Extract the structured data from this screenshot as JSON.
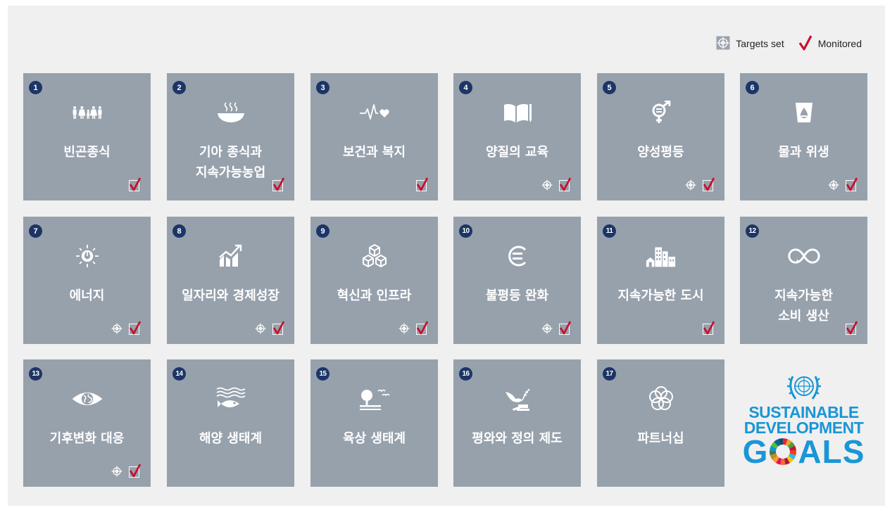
{
  "legend": {
    "targets_label": "Targets set",
    "monitored_label": "Monitored",
    "targets_icon": "target-icon",
    "monitored_icon": "checkmark-icon"
  },
  "goals": [
    {
      "number": "1",
      "title": "빈곤종식",
      "icon": "family-icon",
      "targets_set": false,
      "monitored": true
    },
    {
      "number": "2",
      "title": "기아 종식과\n지속가능농업",
      "icon": "food-bowl-icon",
      "targets_set": false,
      "monitored": true
    },
    {
      "number": "3",
      "title": "보건과 복지",
      "icon": "heartbeat-icon",
      "targets_set": false,
      "monitored": true
    },
    {
      "number": "4",
      "title": "양질의 교육",
      "icon": "book-pencil-icon",
      "targets_set": true,
      "monitored": true
    },
    {
      "number": "5",
      "title": "양성평등",
      "icon": "gender-equality-icon",
      "targets_set": true,
      "monitored": true
    },
    {
      "number": "6",
      "title": "물과 위생",
      "icon": "water-glass-icon",
      "targets_set": true,
      "monitored": true
    },
    {
      "number": "7",
      "title": "에너지",
      "icon": "sun-power-icon",
      "targets_set": true,
      "monitored": true
    },
    {
      "number": "8",
      "title": "일자리와 경제성장",
      "icon": "growth-chart-icon",
      "targets_set": true,
      "monitored": true
    },
    {
      "number": "9",
      "title": "혁신과 인프라",
      "icon": "cubes-icon",
      "targets_set": true,
      "monitored": true
    },
    {
      "number": "10",
      "title": "불평등 완화",
      "icon": "equal-sign-icon",
      "targets_set": true,
      "monitored": true
    },
    {
      "number": "11",
      "title": "지속가능한 도시",
      "icon": "city-buildings-icon",
      "targets_set": false,
      "monitored": true
    },
    {
      "number": "12",
      "title": "지속가능한\n소비 생산",
      "icon": "infinity-loop-icon",
      "targets_set": false,
      "monitored": true
    },
    {
      "number": "13",
      "title": "기후변화 대응",
      "icon": "eye-globe-icon",
      "targets_set": true,
      "monitored": true
    },
    {
      "number": "14",
      "title": "해양 생태계",
      "icon": "fish-waves-icon",
      "targets_set": false,
      "monitored": false
    },
    {
      "number": "15",
      "title": "육상 생태계",
      "icon": "tree-birds-icon",
      "targets_set": false,
      "monitored": false
    },
    {
      "number": "16",
      "title": "평와와 정의 제도",
      "icon": "dove-gavel-icon",
      "targets_set": false,
      "monitored": false
    },
    {
      "number": "17",
      "title": "파트너십",
      "icon": "interlocking-rings-icon",
      "targets_set": false,
      "monitored": false
    }
  ],
  "logo": {
    "line1": "SUSTAINABLE",
    "line2": "DEVELOPMENT",
    "goals_left": "G",
    "goals_right": "ALS",
    "emblem_icon": "un-emblem-icon",
    "wheel_icon": "sdg-wheel-icon",
    "color": "#1a96d6"
  },
  "colors": {
    "tile": "#97a1ac",
    "badge": "#1d3566",
    "check": "#c8102e"
  }
}
